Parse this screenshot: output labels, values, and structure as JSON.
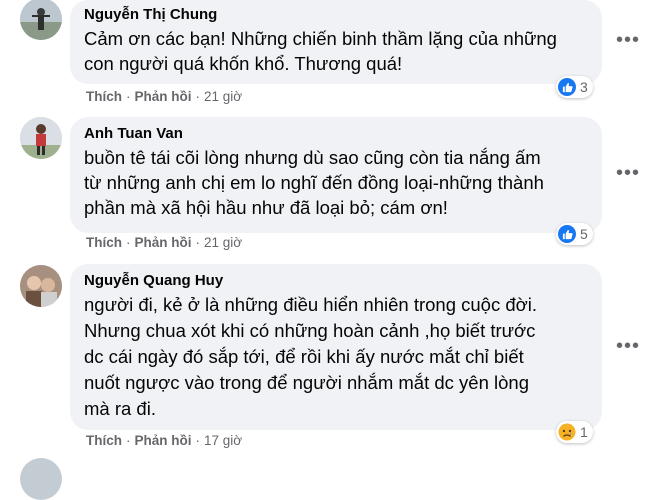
{
  "comments": [
    {
      "author": "Nguyễn Thị Chung",
      "text": "Cảm ơn các bạn! Những chiến binh thầm lặng của những\ncon người quá khốn khổ. Thương quá!",
      "like_label": "Thích",
      "reply_label": "Phản hồi",
      "time": "21 giờ",
      "reaction_icon": "like-icon",
      "reaction_count": "3"
    },
    {
      "author": "Anh Tuan Van",
      "text": "buồn tê tái cõi lòng nhưng dù sao cũng còn tia nắng ấm\ntừ những anh chị em lo nghĩ đến đồng loại-những thành\nphần mà xã hội hầu như đã loại bỏ; cám ơn!",
      "like_label": "Thích",
      "reply_label": "Phản hồi",
      "time": "21 giờ",
      "reaction_icon": "like-icon",
      "reaction_count": "5"
    },
    {
      "author": "Nguyễn Quang Huy",
      "text": "người đi, kẻ ở là những điều hiển nhiên trong cuộc đời.\nNhưng chua xót khi có những hoàn cảnh ,họ biết trước\ndc cái ngày đó sắp tới, để rồi khi ấy nước mắt chỉ biết\nnuốt ngược vào trong để người nhắm mắt dc yên lòng\nmà ra đi.",
      "like_label": "Thích",
      "reply_label": "Phản hồi",
      "time": "17 giờ",
      "reaction_icon": "sad-icon",
      "reaction_count": "1"
    }
  ],
  "colors": {
    "bubble": "#f0f2f5",
    "meta": "#65676b",
    "like_blue": "#1877f2"
  },
  "more_icon": "more-options-icon"
}
